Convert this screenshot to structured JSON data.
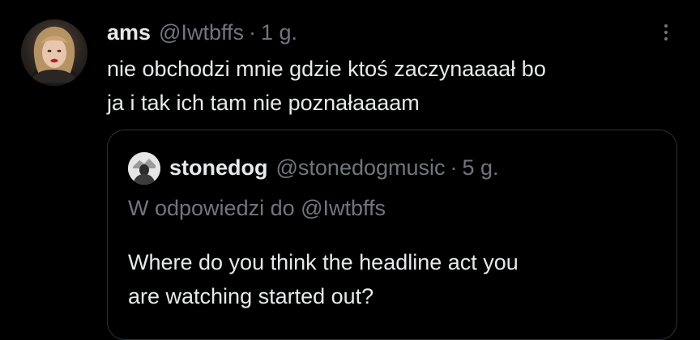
{
  "post": {
    "avatar_icon": "user-avatar",
    "display_name": "ams",
    "handle": "@Iwtbffs",
    "separator": "·",
    "time": "1 g.",
    "more_icon": "more-vertical-icon",
    "text": "nie obchodzi mnie gdzie ktoś zaczynaaaał bo\nja i tak ich tam nie poznałaaaam"
  },
  "quoted_post": {
    "avatar_icon": "user-avatar",
    "display_name": "stonedog",
    "handle": "@stonedogmusic",
    "separator": "·",
    "time": "5 g.",
    "reply_context": "W odpowiedzi do @Iwtbffs",
    "text": "Where do you think the headline act you\nare watching started out?"
  },
  "colors": {
    "background": "#000000",
    "primary_text": "#e7e9ea",
    "secondary_text": "#71767b",
    "border": "#2f3336"
  }
}
